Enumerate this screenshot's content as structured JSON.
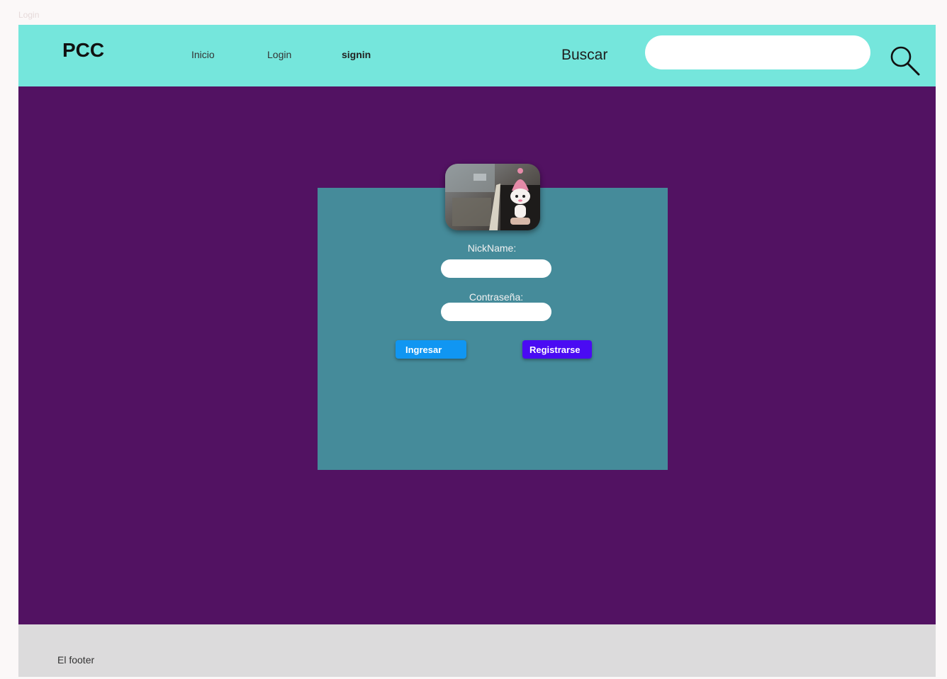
{
  "frame": {
    "label": "Login"
  },
  "navbar": {
    "brand": "PCC",
    "links": [
      {
        "label": "Inicio"
      },
      {
        "label": "Login"
      },
      {
        "label": "signin"
      }
    ],
    "search": {
      "label": "Buscar",
      "value": "",
      "icon": "search-icon"
    }
  },
  "login": {
    "avatar_icon": "avatar-photo",
    "nickname_label": "NickName:",
    "nickname_value": "",
    "password_label": "Contraseña:",
    "password_value": "",
    "ingresar_label": "Ingresar",
    "registrarse_label": "Registrarse"
  },
  "footer": {
    "text": "El footer"
  },
  "colors": {
    "page_bg": "#521262",
    "navbar_bg": "#75e6dc",
    "card_bg": "#458b9a",
    "ingresar_bg": "#1096f2",
    "registrarse_bg": "#4a0bf3",
    "footer_bg": "#dcdbdc"
  }
}
